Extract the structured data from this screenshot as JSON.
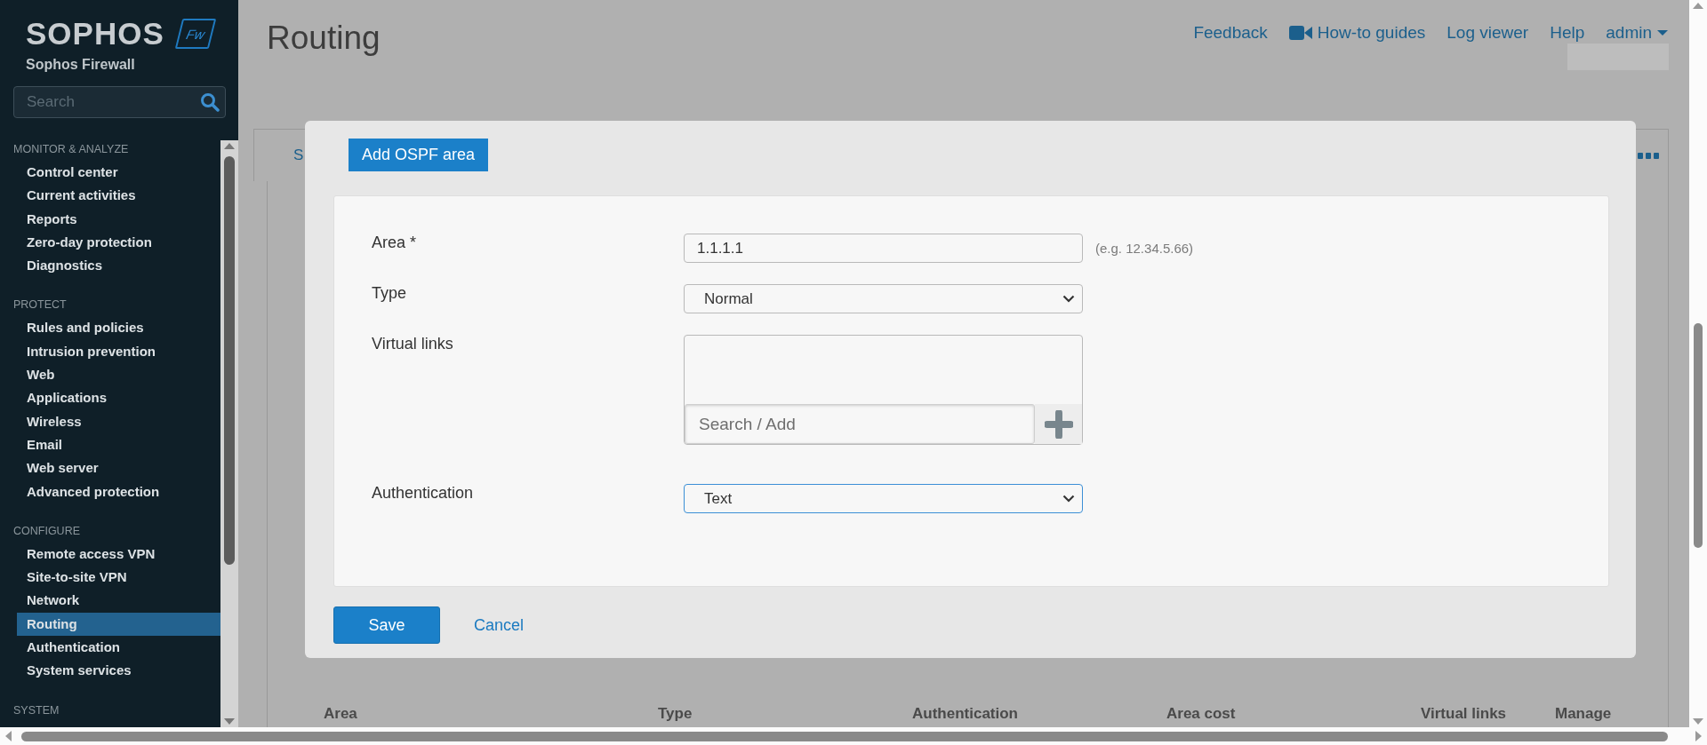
{
  "sidebar": {
    "logo": "SOPHOS",
    "badge": "Fw",
    "product": "Sophos Firewall",
    "search": {
      "placeholder": "Search"
    },
    "sections": [
      {
        "title": "MONITOR & ANALYZE",
        "items": [
          {
            "label": "Control center",
            "selected": false
          },
          {
            "label": "Current activities",
            "selected": false
          },
          {
            "label": "Reports",
            "selected": false
          },
          {
            "label": "Zero-day protection",
            "selected": false
          },
          {
            "label": "Diagnostics",
            "selected": false
          }
        ]
      },
      {
        "title": "PROTECT",
        "items": [
          {
            "label": "Rules and policies",
            "selected": false
          },
          {
            "label": "Intrusion prevention",
            "selected": false
          },
          {
            "label": "Web",
            "selected": false
          },
          {
            "label": "Applications",
            "selected": false
          },
          {
            "label": "Wireless",
            "selected": false
          },
          {
            "label": "Email",
            "selected": false
          },
          {
            "label": "Web server",
            "selected": false
          },
          {
            "label": "Advanced protection",
            "selected": false
          }
        ]
      },
      {
        "title": "CONFIGURE",
        "items": [
          {
            "label": "Remote access VPN",
            "selected": false
          },
          {
            "label": "Site-to-site VPN",
            "selected": false
          },
          {
            "label": "Network",
            "selected": false
          },
          {
            "label": "Routing",
            "selected": true
          },
          {
            "label": "Authentication",
            "selected": false
          },
          {
            "label": "System services",
            "selected": false
          }
        ]
      },
      {
        "title": "SYSTEM"
      }
    ]
  },
  "header": {
    "title": "Routing",
    "links": [
      {
        "label": "Feedback",
        "kind": "link"
      },
      {
        "label": "How-to guides",
        "kind": "video"
      },
      {
        "label": "Log viewer",
        "kind": "link"
      },
      {
        "label": "Help",
        "kind": "link"
      },
      {
        "label": "admin",
        "kind": "menu"
      }
    ]
  },
  "background_tab": {
    "label": "S"
  },
  "table": {
    "columns": [
      "Area",
      "Type",
      "Authentication",
      "Area cost",
      "Virtual links",
      "Manage"
    ]
  },
  "dialog": {
    "tab": "Add OSPF area",
    "fields": [
      {
        "kind": "text",
        "label": "Area *",
        "value": "1.1.1.1",
        "hint": "(e.g. 12.34.5.66)"
      },
      {
        "kind": "select",
        "label": "Type",
        "value": "Normal",
        "focused": false
      },
      {
        "kind": "list",
        "label": "Virtual links",
        "placeholder": "Search / Add"
      },
      {
        "kind": "select",
        "label": "Authentication",
        "value": "Text",
        "focused": true
      }
    ],
    "buttons": [
      {
        "label": "Save",
        "kind": "primary"
      },
      {
        "label": "Cancel",
        "kind": "link"
      }
    ]
  }
}
